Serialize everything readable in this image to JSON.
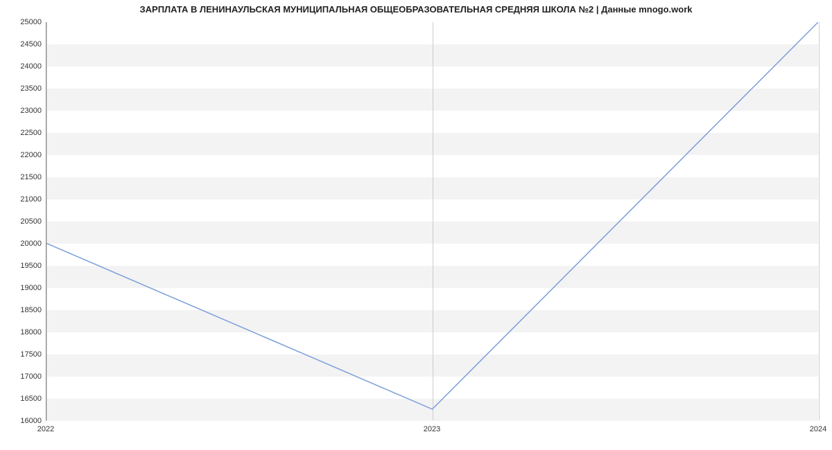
{
  "chart_data": {
    "type": "line",
    "title": "ЗАРПЛАТА В ЛЕНИНАУЛЬСКАЯ МУНИЦИПАЛЬНАЯ ОБЩЕОБРАЗОВАТЕЛЬНАЯ СРЕДНЯЯ ШКОЛА №2 | Данные mnogo.work",
    "xlabel": "",
    "ylabel": "",
    "x": [
      2022,
      2023,
      2024
    ],
    "x_ticks": [
      "2022",
      "2023",
      "2024"
    ],
    "values": [
      20000,
      16250,
      25000
    ],
    "y_ticks": [
      16000,
      16500,
      17000,
      17500,
      18000,
      18500,
      19000,
      19500,
      20000,
      20500,
      21000,
      21500,
      22000,
      22500,
      23000,
      23500,
      24000,
      24500,
      25000
    ],
    "ylim": [
      16000,
      25000
    ],
    "xlim": [
      2022,
      2024
    ],
    "grid": true,
    "line_color": "#7a9ed9"
  }
}
